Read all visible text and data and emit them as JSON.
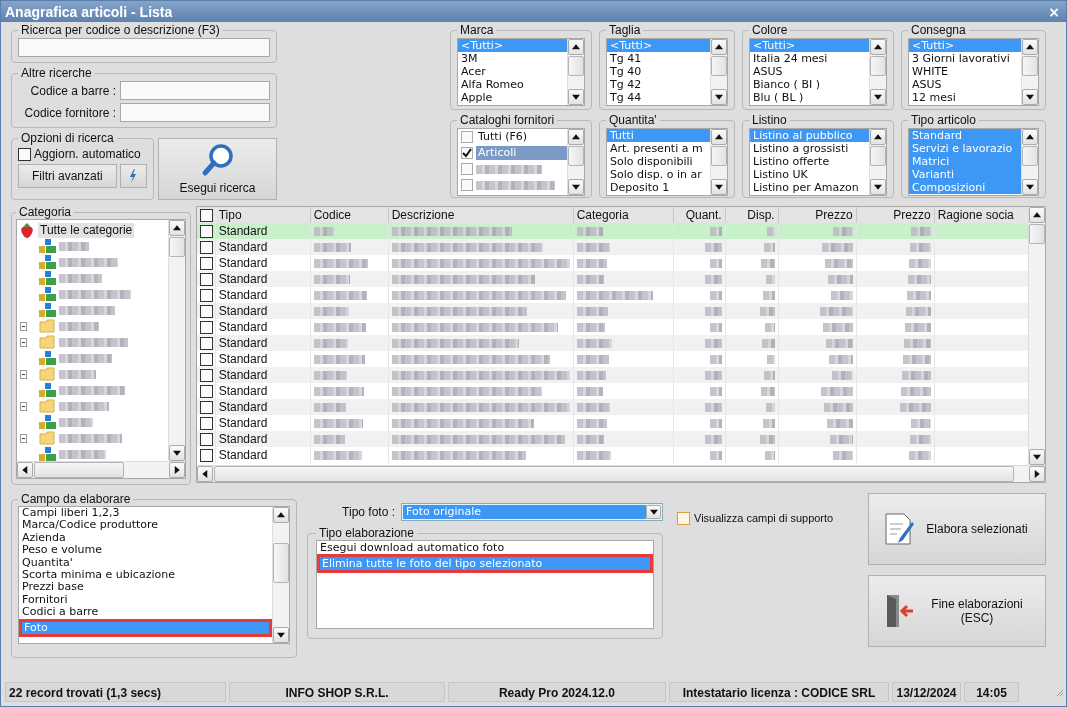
{
  "window": {
    "title": "Anagrafica articoli  - Lista",
    "close": "×"
  },
  "search": {
    "title": "Ricerca per codice o descrizione (F3)"
  },
  "other_searches": {
    "title": "Altre ricerche",
    "fields": [
      {
        "label": "Codice a barre :"
      },
      {
        "label": "Codice fornitore :"
      }
    ]
  },
  "search_options": {
    "title": "Opzioni di ricerca",
    "auto_update": {
      "label": "Aggiorn. automatico",
      "checked": false
    },
    "advanced_button": "Filtri avanzati"
  },
  "search_button": "Esegui ricerca",
  "filters": [
    {
      "title": "Marca",
      "items": [
        {
          "label": "<Tutti>",
          "selected": true
        },
        {
          "label": "3M",
          "selected": false
        },
        {
          "label": "Acer",
          "selected": false
        },
        {
          "label": "Alfa Romeo",
          "selected": false
        },
        {
          "label": "Apple",
          "selected": false
        }
      ]
    },
    {
      "title": "Taglia",
      "items": [
        {
          "label": "<Tutti>",
          "selected": true
        },
        {
          "label": "Tg 41",
          "selected": false
        },
        {
          "label": "Tg 40",
          "selected": false
        },
        {
          "label": "Tg 42",
          "selected": false
        },
        {
          "label": "Tg 44",
          "selected": false
        }
      ]
    },
    {
      "title": "Colore",
      "items": [
        {
          "label": "<Tutti>",
          "selected": true
        },
        {
          "label": "Italia 24 mesi",
          "selected": false
        },
        {
          "label": "ASUS",
          "selected": false
        },
        {
          "label": "Bianco ( BI )",
          "selected": false
        },
        {
          "label": "Blu ( BL )",
          "selected": false
        }
      ]
    },
    {
      "title": "Consegna",
      "items": [
        {
          "label": "<Tutti>",
          "selected": true
        },
        {
          "label": "3 Giorni lavorativi",
          "selected": false
        },
        {
          "label": "WHITE",
          "selected": false
        },
        {
          "label": "ASUS",
          "selected": false
        },
        {
          "label": "12 mesi",
          "selected": false
        }
      ]
    },
    {
      "title": "Cataloghi fornitori",
      "items": [
        {
          "kind": "check",
          "label": "Tutti (F6)",
          "checked": false,
          "selected": false
        },
        {
          "kind": "check",
          "label": "Articoli",
          "checked": true,
          "selected": true
        },
        {
          "kind": "blurred",
          "checked": false
        },
        {
          "kind": "blurred",
          "checked": false
        }
      ]
    },
    {
      "title": "Quantita'",
      "items": [
        {
          "label": "Tutti",
          "selected": true
        },
        {
          "label": "Art. presenti a m",
          "selected": false
        },
        {
          "label": "Solo disponibili",
          "selected": false
        },
        {
          "label": "Solo disp. o in ar",
          "selected": false
        },
        {
          "label": "Deposito 1",
          "selected": false
        }
      ]
    },
    {
      "title": "Listino",
      "items": [
        {
          "label": "Listino al pubblico",
          "selected": true
        },
        {
          "label": "Listino a grossisti",
          "selected": false
        },
        {
          "label": "Listino offerte",
          "selected": false
        },
        {
          "label": "Listino UK",
          "selected": false
        },
        {
          "label": "Listino per Amazon",
          "selected": false
        }
      ]
    },
    {
      "title": "Tipo articolo",
      "items": [
        {
          "label": "Standard",
          "selected": true
        },
        {
          "label": "Servizi e lavorazio",
          "selected": true
        },
        {
          "label": "Matrici",
          "selected": true
        },
        {
          "label": "Varianti",
          "selected": true
        },
        {
          "label": "Composizioni",
          "selected": true
        }
      ]
    }
  ],
  "categories": {
    "title": "Categoria",
    "root": {
      "label": "Tutte le categorie",
      "selected": true,
      "children": [
        {
          "kind": "item"
        },
        {
          "kind": "item"
        },
        {
          "kind": "item"
        },
        {
          "kind": "item"
        },
        {
          "kind": "item"
        },
        {
          "kind": "folder"
        },
        {
          "kind": "folder"
        },
        {
          "kind": "item"
        },
        {
          "kind": "folder"
        },
        {
          "kind": "item"
        },
        {
          "kind": "folder"
        },
        {
          "kind": "item"
        },
        {
          "kind": "folder"
        },
        {
          "kind": "item"
        }
      ]
    }
  },
  "table": {
    "all_checked": false,
    "columns": [
      {
        "label": "Tipo"
      },
      {
        "label": "Codice"
      },
      {
        "label": "Descrizione"
      },
      {
        "label": "Categoria"
      },
      {
        "label": "Quant."
      },
      {
        "label": "Disp."
      },
      {
        "label": "Prezzo"
      },
      {
        "label": "Prezzo"
      },
      {
        "label": "Ragione socia"
      }
    ],
    "rows": [
      {
        "tipo": "Standard",
        "checked": false,
        "selected": true
      },
      {
        "tipo": "Standard",
        "checked": false,
        "selected": false
      },
      {
        "tipo": "Standard",
        "checked": false,
        "selected": false
      },
      {
        "tipo": "Standard",
        "checked": false,
        "selected": false
      },
      {
        "tipo": "Standard",
        "checked": false,
        "selected": false
      },
      {
        "tipo": "Standard",
        "checked": false,
        "selected": false
      },
      {
        "tipo": "Standard",
        "checked": false,
        "selected": false
      },
      {
        "tipo": "Standard",
        "checked": false,
        "selected": false
      },
      {
        "tipo": "Standard",
        "checked": false,
        "selected": false
      },
      {
        "tipo": "Standard",
        "checked": false,
        "selected": false
      },
      {
        "tipo": "Standard",
        "checked": false,
        "selected": false
      },
      {
        "tipo": "Standard",
        "checked": false,
        "selected": false
      },
      {
        "tipo": "Standard",
        "checked": false,
        "selected": false
      },
      {
        "tipo": "Standard",
        "checked": false,
        "selected": false
      },
      {
        "tipo": "Standard",
        "checked": false,
        "selected": false
      }
    ]
  },
  "processing": {
    "field_title": "Campo da elaborare",
    "fields": [
      {
        "label": "Campi liberi 1,2,3",
        "selected": false,
        "highlighted": false
      },
      {
        "label": "Marca/Codice produttore",
        "selected": false,
        "highlighted": false
      },
      {
        "label": "Azienda",
        "selected": false,
        "highlighted": false
      },
      {
        "label": "Peso e volume",
        "selected": false,
        "highlighted": false
      },
      {
        "label": "Quantita'",
        "selected": false,
        "highlighted": false
      },
      {
        "label": "Scorta minima e ubicazione",
        "selected": false,
        "highlighted": false
      },
      {
        "label": "Prezzi base",
        "selected": false,
        "highlighted": false
      },
      {
        "label": "Fornitori",
        "selected": false,
        "highlighted": false
      },
      {
        "label": "Codici a barre",
        "selected": false,
        "highlighted": false
      },
      {
        "label": "Foto",
        "selected": true,
        "highlighted": true
      }
    ],
    "photo_type": {
      "label": "Tipo foto :",
      "value": "Foto originale"
    },
    "processing_title": "Tipo elaborazione",
    "processing_items": [
      {
        "label": "Esegui download automatico foto",
        "selected": false,
        "highlighted": false
      },
      {
        "label": "Elimina tutte le foto del tipo selezionato",
        "selected": true,
        "highlighted": true
      }
    ],
    "support_fields": {
      "label": "Visualizza campi di supporto",
      "checked": false
    }
  },
  "actions": [
    {
      "kind": "process",
      "label": "Elabora selezionati"
    },
    {
      "kind": "exit",
      "label": "Fine elaborazioni (ESC)"
    }
  ],
  "status_bar": [
    "22 record trovati (1,3 secs)",
    "INFO SHOP S.R.L.",
    "Ready Pro 2024.12.0",
    "Intestatario licenza : CODICE SRL",
    "13/12/2024",
    "14:05"
  ]
}
